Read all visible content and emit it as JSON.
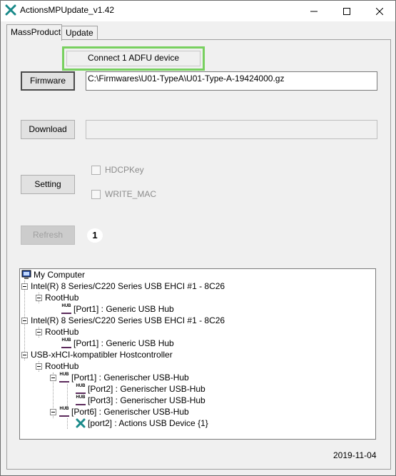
{
  "window": {
    "title": "ActionsMPUpdate_v1.42"
  },
  "tabs": [
    {
      "label": "MassProduct"
    },
    {
      "label": "Update"
    }
  ],
  "status": {
    "text": "Connect 1 ADFU device"
  },
  "firmware": {
    "button_label": "Firmware",
    "path": "C:\\Firmwares\\U01-TypeA\\U01-Type-A-19424000.gz"
  },
  "download": {
    "button_label": "Download",
    "value": ""
  },
  "setting": {
    "button_label": "Setting"
  },
  "options": {
    "hdcpkey_label": "HDCPKey",
    "write_mac_label": "WRITE_MAC"
  },
  "refresh": {
    "button_label": "Refresh",
    "device_count": "1"
  },
  "tree": {
    "root": "My Computer",
    "items": [
      "Intel(R) 8 Series/C220 Series USB EHCI #1 - 8C26",
      "RootHub",
      "[Port1] : Generic USB Hub",
      "Intel(R) 8 Series/C220 Series USB EHCI #1 - 8C26",
      "RootHub",
      "[Port1] : Generic USB Hub",
      "USB-xHCI-kompatibler Hostcontroller",
      "RootHub",
      "[Port1] : Generischer USB-Hub",
      "[Port2] : Generischer USB-Hub",
      "[Port3] : Generischer USB-Hub",
      "[Port6] : Generischer USB-Hub",
      "[port2] : Actions USB Device {1}"
    ]
  },
  "footer": {
    "date": "2019-11-04"
  }
}
